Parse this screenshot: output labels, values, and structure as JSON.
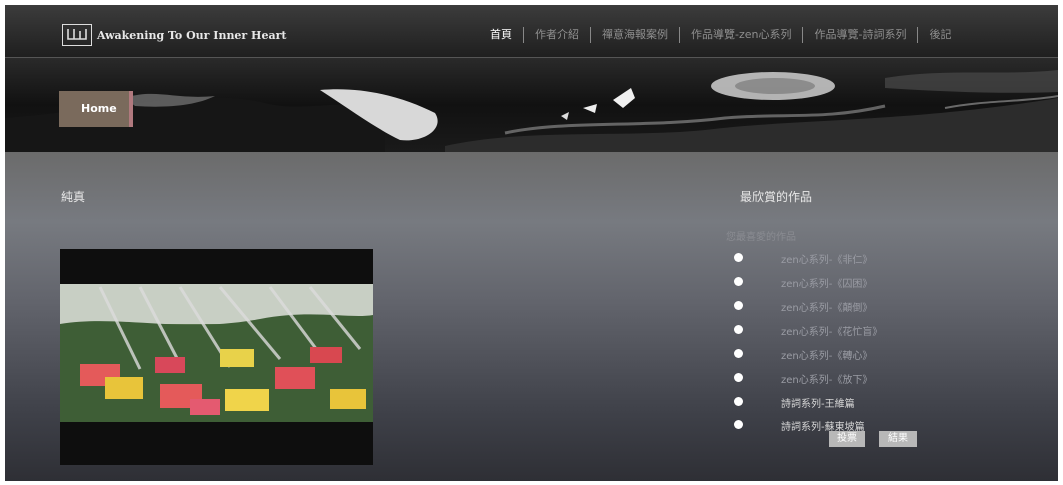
{
  "header": {
    "site_title": "Awakening To Our Inner Heart",
    "nav": [
      {
        "label": "首頁",
        "active": true
      },
      {
        "label": "作者介紹",
        "active": false
      },
      {
        "label": "禪意海報案例",
        "active": false
      },
      {
        "label": "作品導覽-zen心系列",
        "active": false
      },
      {
        "label": "作品導覽-詩詞系列",
        "active": false
      },
      {
        "label": "後記",
        "active": false
      }
    ]
  },
  "banner": {
    "home_label": "Home"
  },
  "left": {
    "heading": "純真"
  },
  "poll": {
    "heading": "最欣賞的作品",
    "subtitle": "您最喜愛的作品",
    "options": [
      "zen心系列-《非仁》",
      "zen心系列-《囚困》",
      "zen心系列-《顛倒》",
      "zen心系列-《花忙盲》",
      "zen心系列-《轉心》",
      "zen心系列-《放下》",
      "詩詞系列-王維篇",
      "詩詞系列-蘇東坡篇"
    ],
    "vote_label": "投票",
    "result_label": "結果"
  }
}
